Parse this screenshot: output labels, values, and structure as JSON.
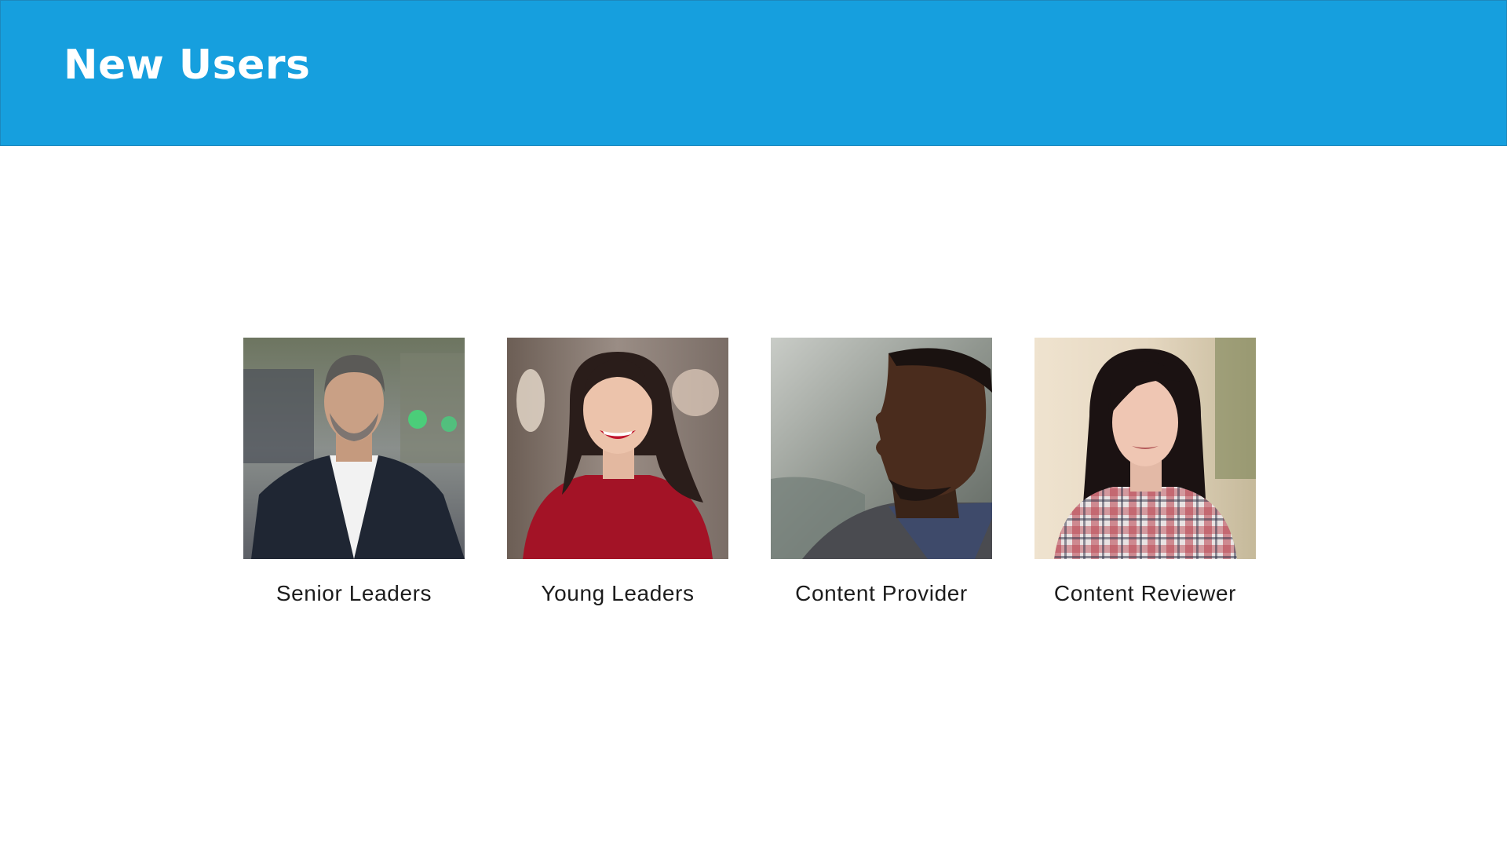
{
  "header": {
    "title": "New Users",
    "background_color": "#169fde"
  },
  "users": [
    {
      "label": "Senior Leaders",
      "icon": "portrait-man-suit"
    },
    {
      "label": "Young Leaders",
      "icon": "portrait-woman-red-top"
    },
    {
      "label": "Content Provider",
      "icon": "portrait-man-profile"
    },
    {
      "label": "Content Reviewer",
      "icon": "portrait-woman-plaid-shirt"
    }
  ]
}
